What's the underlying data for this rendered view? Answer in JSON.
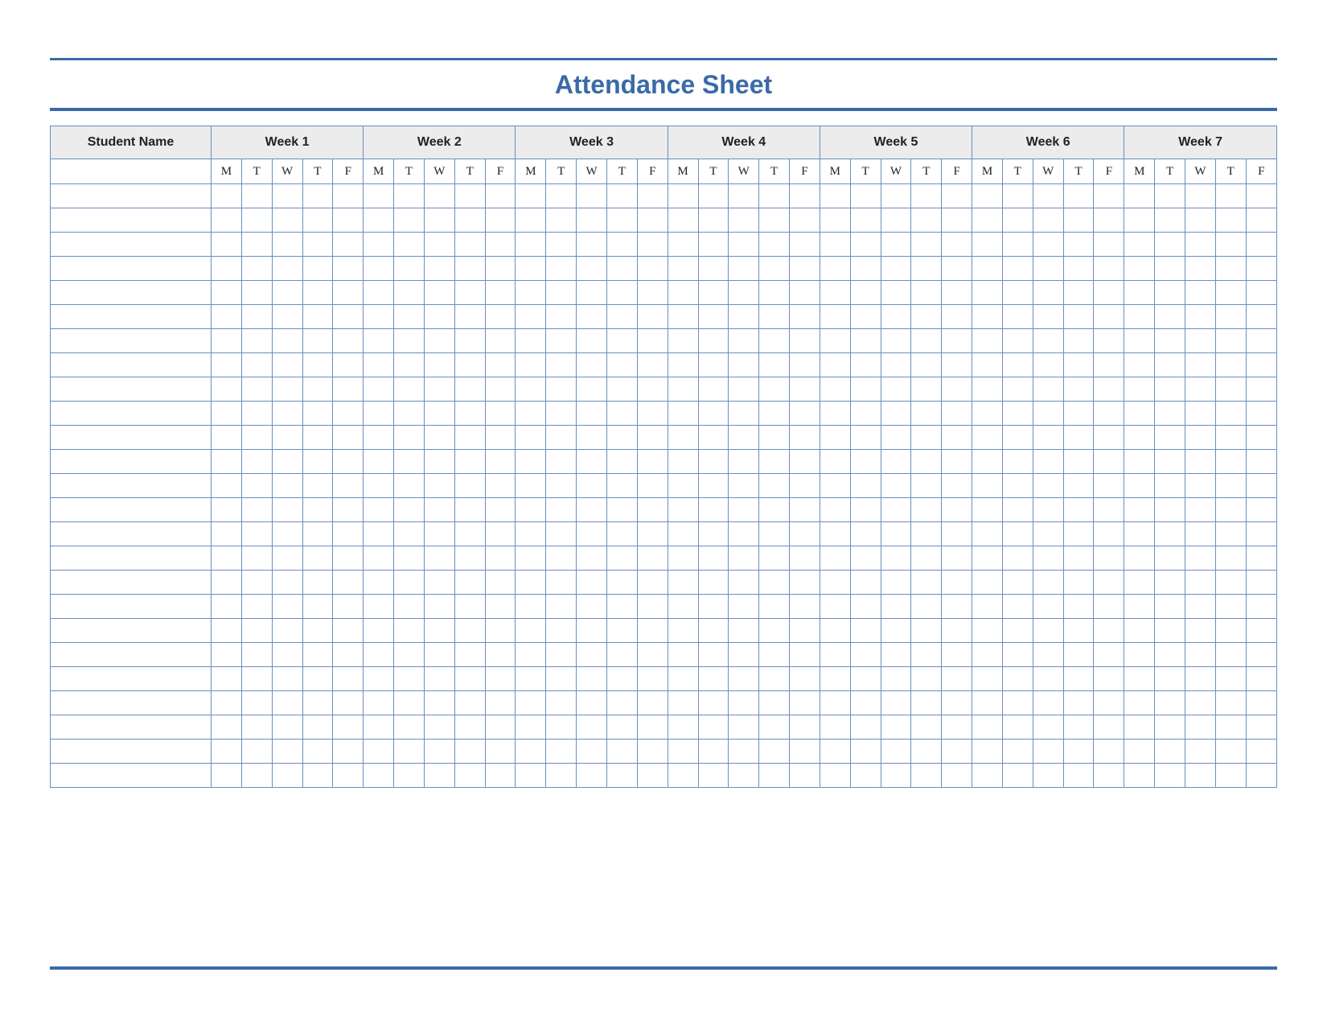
{
  "title": "Attendance Sheet",
  "name_header": "Student Name",
  "weeks": [
    "Week 1",
    "Week 2",
    "Week 3",
    "Week 4",
    "Week 5",
    "Week 6",
    "Week 7"
  ],
  "days": [
    "M",
    "T",
    "W",
    "T",
    "F"
  ],
  "row_count": 25
}
